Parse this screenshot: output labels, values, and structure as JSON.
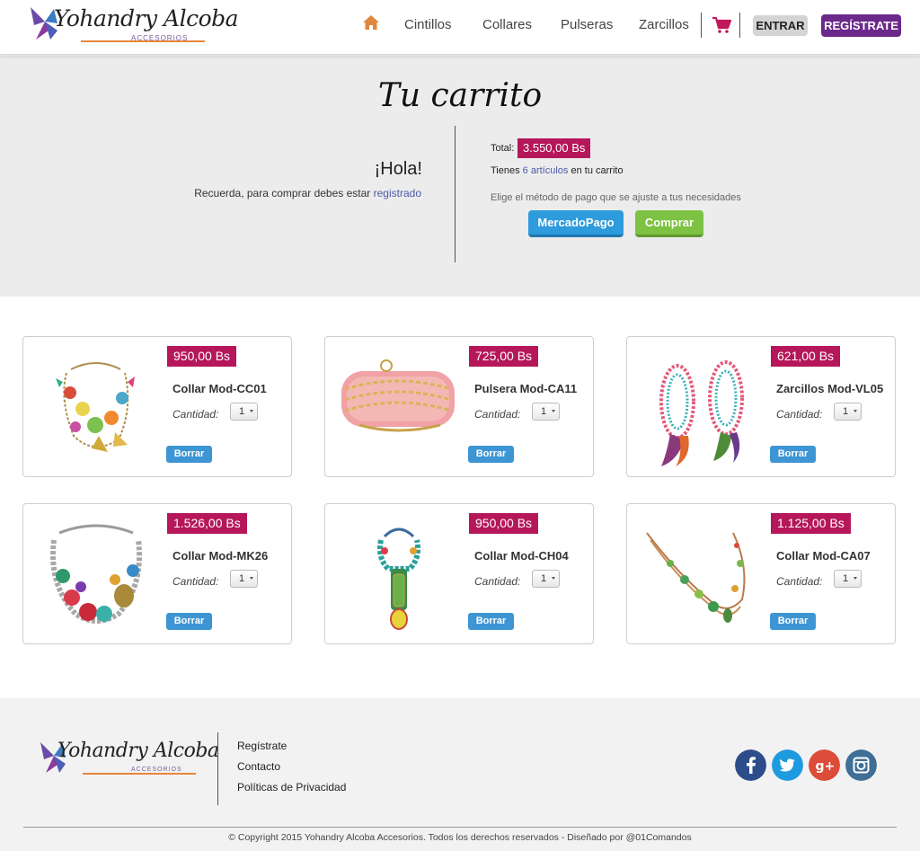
{
  "brand": {
    "name": "Yohandry Alcoba",
    "sub": "ACCESORIOS"
  },
  "nav": {
    "items": [
      "Cintillos",
      "Collares",
      "Pulseras",
      "Zarcillos"
    ],
    "login": "ENTRAR",
    "register": "REGÍSTRATE"
  },
  "cart": {
    "title": "Tu carrito",
    "greeting": "¡Hola!",
    "reminder_prefix": "Recuerda, para comprar debes estar ",
    "reminder_link": "registrado",
    "total_label": "Total:",
    "total_value": "3.550,00 Bs",
    "items_prefix": "Tienes ",
    "items_link": "6 artículos",
    "items_suffix": " en tu carrito",
    "payment_hint": "Elige el método de pago que se ajuste a tus necesidades",
    "btn_mercadopago": "MercadoPago",
    "btn_comprar": "Comprar"
  },
  "products": [
    {
      "price": "950,00 Bs",
      "name": "Collar Mod-CC01",
      "qty_label": "Cantidad:",
      "qty": "1",
      "delete": "Borrar"
    },
    {
      "price": "725,00 Bs",
      "name": "Pulsera Mod-CA11",
      "qty_label": "Cantidad:",
      "qty": "1",
      "delete": "Borrar"
    },
    {
      "price": "621,00 Bs",
      "name": "Zarcillos Mod-VL05",
      "qty_label": "Cantidad:",
      "qty": "1",
      "delete": "Borrar"
    },
    {
      "price": "1.526,00 Bs",
      "name": "Collar Mod-MK26",
      "qty_label": "Cantidad:",
      "qty": "1",
      "delete": "Borrar"
    },
    {
      "price": "950,00 Bs",
      "name": "Collar Mod-CH04",
      "qty_label": "Cantidad:",
      "qty": "1",
      "delete": "Borrar"
    },
    {
      "price": "1.125,00 Bs",
      "name": "Collar Mod-CA07",
      "qty_label": "Cantidad:",
      "qty": "1",
      "delete": "Borrar"
    }
  ],
  "footer": {
    "links": [
      "Regístrate",
      "Contacto",
      "Políticas de Privacidad"
    ],
    "social": [
      "facebook-icon",
      "twitter-icon",
      "google-plus-icon",
      "instagram-icon"
    ],
    "copyright": "© Copyright 2015 Yohandry Alcoba Accesorios. Todos los derechos reservados - Diseñado por @01Comandos"
  },
  "colors": {
    "brand_purple": "#6b2a8b",
    "price_magenta": "#b5175a",
    "accent_orange": "#e8863b",
    "mercadopago_blue": "#2e9bdc",
    "comprar_green": "#7dc242",
    "borrar_blue": "#3d95d4"
  }
}
